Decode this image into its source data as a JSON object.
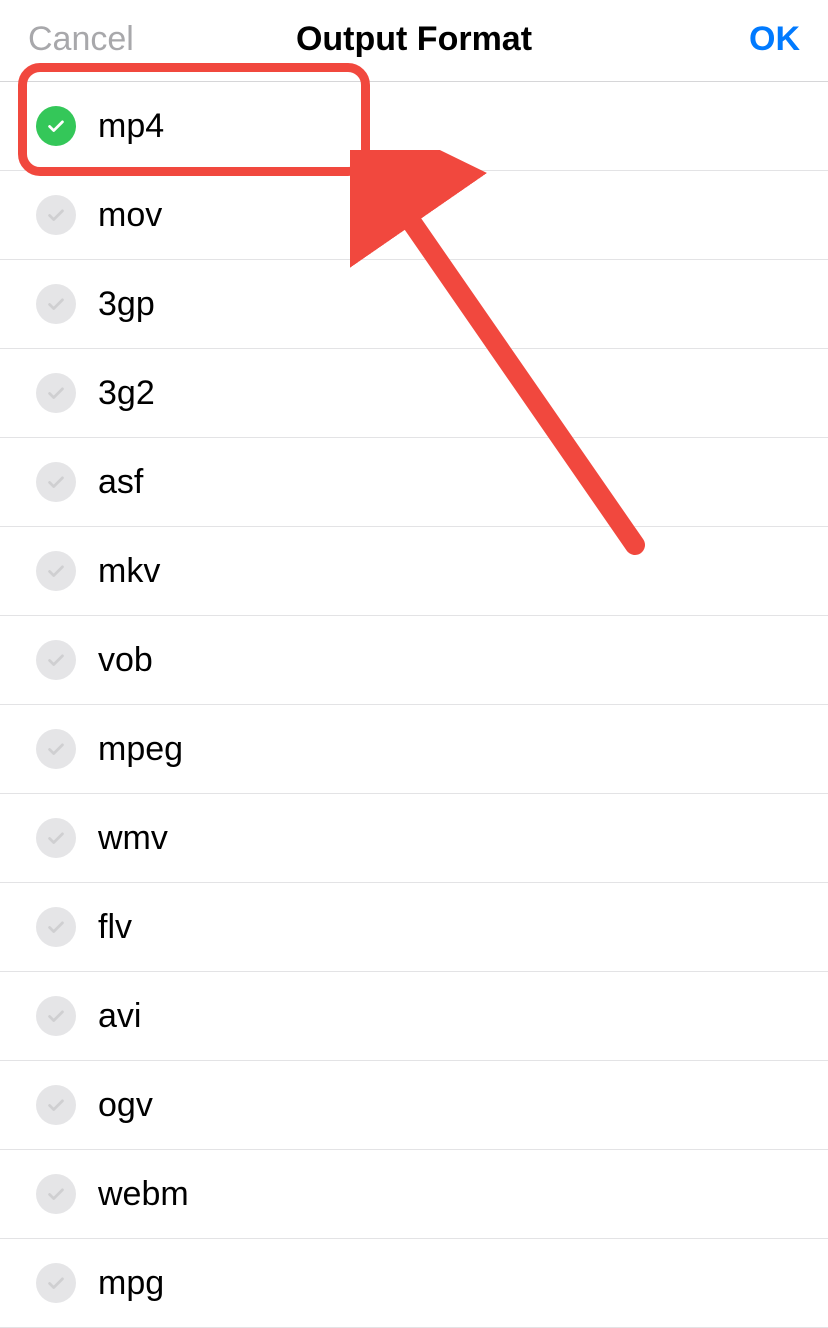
{
  "header": {
    "cancel": "Cancel",
    "title": "Output Format",
    "ok": "OK"
  },
  "annotation": {
    "color": "#f1483e"
  },
  "formats": [
    {
      "label": "mp4",
      "selected": true
    },
    {
      "label": "mov",
      "selected": false
    },
    {
      "label": "3gp",
      "selected": false
    },
    {
      "label": "3g2",
      "selected": false
    },
    {
      "label": "asf",
      "selected": false
    },
    {
      "label": "mkv",
      "selected": false
    },
    {
      "label": "vob",
      "selected": false
    },
    {
      "label": "mpeg",
      "selected": false
    },
    {
      "label": "wmv",
      "selected": false
    },
    {
      "label": "flv",
      "selected": false
    },
    {
      "label": "avi",
      "selected": false
    },
    {
      "label": "ogv",
      "selected": false
    },
    {
      "label": "webm",
      "selected": false
    },
    {
      "label": "mpg",
      "selected": false
    }
  ]
}
